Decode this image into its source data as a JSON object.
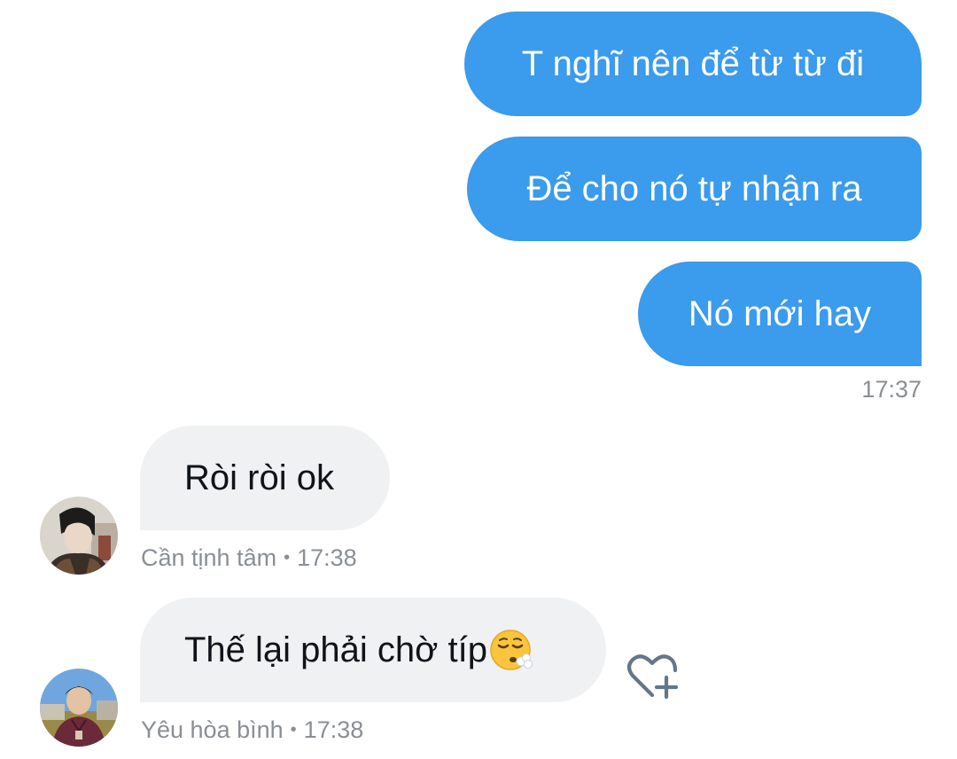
{
  "conversation": {
    "outgoing": [
      {
        "text": "T nghĩ nên để từ từ đi"
      },
      {
        "text": "Để cho nó tự nhận ra"
      },
      {
        "text": "Nó mới hay"
      }
    ],
    "outgoing_timestamp": "17:37",
    "incoming": [
      {
        "text": "Ròi ròi ok",
        "sender": "Cần tịnh tâm",
        "time": "17:38",
        "separator": "•"
      },
      {
        "text": "Thế lại phải chờ típ",
        "emoji": "😮‍💨",
        "sender": "Yêu hòa bình",
        "time": "17:38",
        "separator": "•"
      }
    ]
  },
  "icons": {
    "reaction": "heart-plus-icon",
    "emoji": "face-exhaling-emoji"
  },
  "colors": {
    "outgoing_bubble": "#3b9bec",
    "incoming_bubble": "#eff1f3",
    "meta_text": "#8a8f95",
    "message_text": "#0f1419"
  }
}
